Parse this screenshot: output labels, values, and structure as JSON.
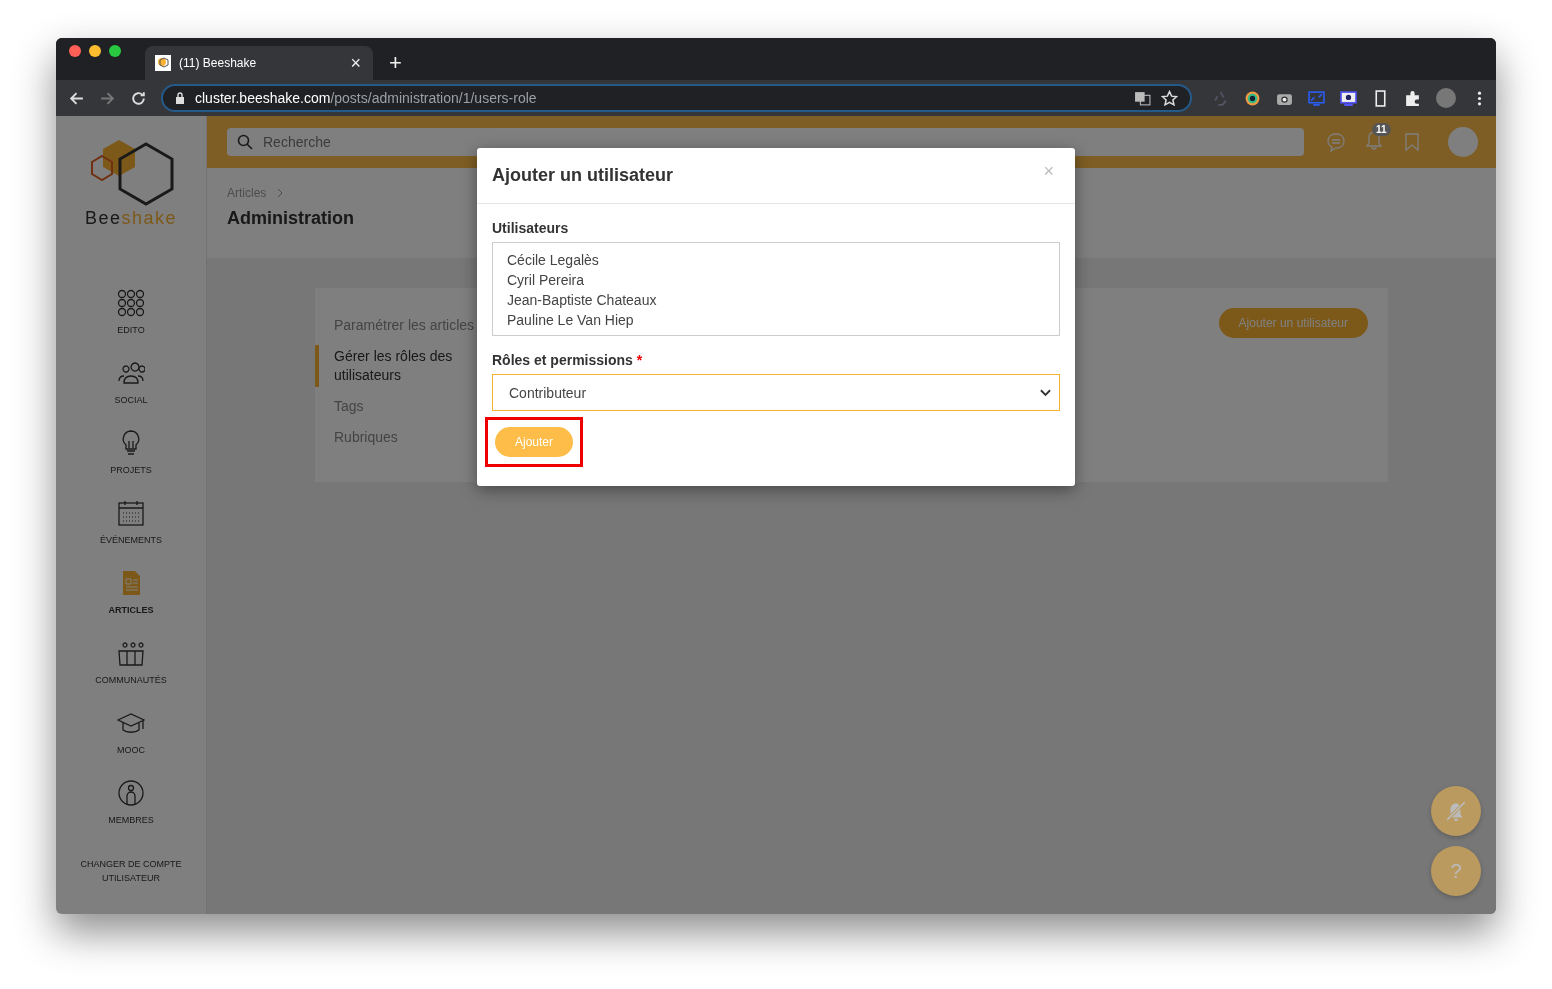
{
  "browser": {
    "tab": {
      "title": "(11) Beeshake",
      "close": "×"
    },
    "new_tab": "+",
    "forward_disabled": true,
    "url": {
      "host": "cluster.beeshake.com",
      "path": "/posts/administration/1/users-role"
    }
  },
  "app": {
    "logo": {
      "first": "Bee",
      "second": "shake"
    },
    "nav": [
      {
        "label": "EDITO",
        "selected": false
      },
      {
        "label": "SOCIAL",
        "selected": false
      },
      {
        "label": "PROJETS",
        "selected": false
      },
      {
        "label": "ÉVÉNEMENTS",
        "selected": false
      },
      {
        "label": "ARTICLES",
        "selected": true
      },
      {
        "label": "COMMUNAUTÉS",
        "selected": false
      },
      {
        "label": "MOOC",
        "selected": false
      },
      {
        "label": "MEMBRES",
        "selected": false
      }
    ],
    "switch_account": "CHANGER DE COMPTE UTILISATEUR",
    "search": {
      "placeholder": "Recherche"
    },
    "notification_count": "11",
    "breadcrumb": [
      "Articles"
    ],
    "page_title": "Administration",
    "settings_menu": [
      {
        "label": "Paramétrer les articles",
        "selected": false
      },
      {
        "label": "Gérer les rôles des utilisateurs",
        "selected": true
      },
      {
        "label": "Tags",
        "selected": false
      },
      {
        "label": "Rubriques",
        "selected": false
      }
    ],
    "add_user_button": "Ajouter un utilisateur",
    "help_button": "?"
  },
  "dialog": {
    "title": "Ajouter un utilisateur",
    "close": "×",
    "users_label": "Utilisateurs",
    "users": [
      "Cécile Legalès",
      "Cyril Pereira",
      "Jean-Baptiste Chateaux",
      "Pauline Le Van Hiep"
    ],
    "role_label": "Rôles et permissions",
    "required_mark": "*",
    "role_value": "Contributeur",
    "submit": {
      "label": "Ajouter",
      "highlighted": true
    }
  }
}
